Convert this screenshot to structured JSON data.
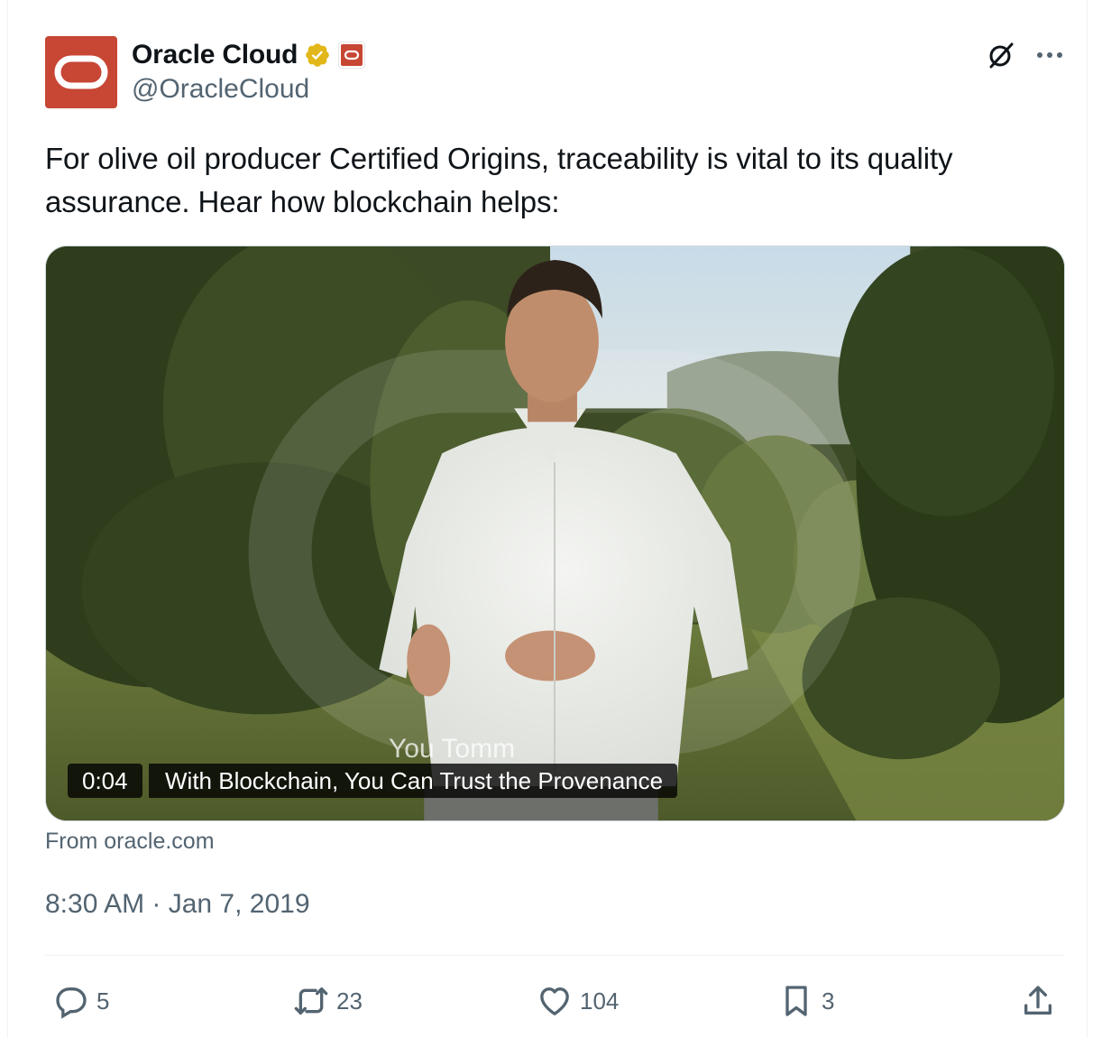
{
  "tweet": {
    "display_name": "Oracle Cloud",
    "handle": "@OracleCloud",
    "text": "For olive oil producer Certified Origins, traceability is vital to its quality assurance. Hear how blockchain helps:",
    "media": {
      "duration": "0:04",
      "title": "With Blockchain, You Can Trust the Provenance",
      "caption": "You Tomm"
    },
    "source": "From oracle.com",
    "timestamp": "8:30 AM · Jan 7, 2019"
  },
  "actions": {
    "replies": "5",
    "reposts": "23",
    "likes": "104",
    "bookmarks": "3"
  },
  "colors": {
    "brand_red": "#c74634",
    "verified_gold": "#e2b719",
    "secondary_text": "#536471"
  },
  "icons": {
    "avatar": "oracle-logo-icon",
    "verified": "verified-gold-badge-icon",
    "affiliation": "oracle-affiliate-badge-icon",
    "grok": "grok-icon",
    "more": "more-dots-icon",
    "reply": "reply-icon",
    "repost": "repost-icon",
    "like": "heart-icon",
    "bookmark": "bookmark-icon",
    "share": "share-icon"
  }
}
